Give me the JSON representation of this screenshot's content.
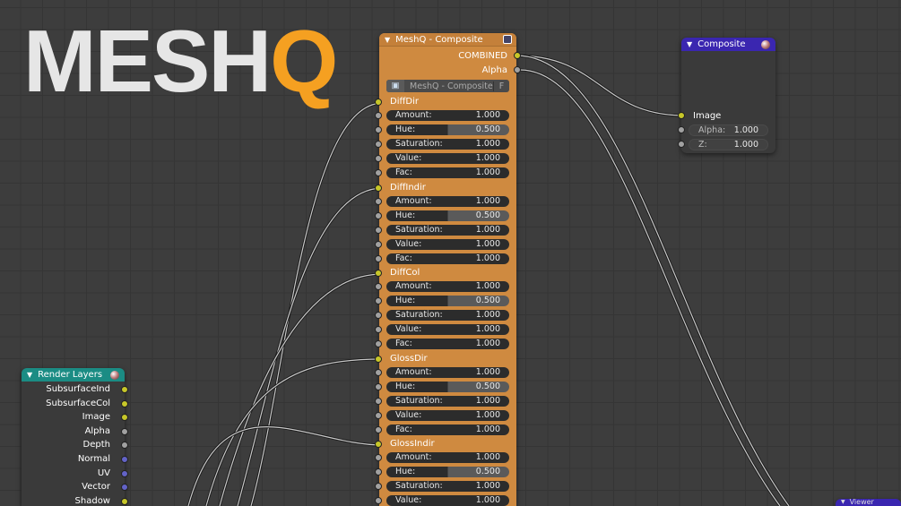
{
  "logo": {
    "text_main": "MESH",
    "text_accent": "Q"
  },
  "main_node": {
    "title": "MeshQ - Composite",
    "outputs": [
      "COMBINED",
      "Alpha"
    ],
    "group_selector": {
      "value": "MeshQ - Composite",
      "fake_user": "F"
    },
    "groups": [
      {
        "name": "DiffDir",
        "rows": [
          [
            "Amount:",
            "1.000"
          ],
          [
            "Hue:",
            "0.500"
          ],
          [
            "Saturation:",
            "1.000"
          ],
          [
            "Value:",
            "1.000"
          ],
          [
            "Fac:",
            "1.000"
          ]
        ]
      },
      {
        "name": "DiffIndir",
        "rows": [
          [
            "Amount:",
            "1.000"
          ],
          [
            "Hue:",
            "0.500"
          ],
          [
            "Saturation:",
            "1.000"
          ],
          [
            "Value:",
            "1.000"
          ],
          [
            "Fac:",
            "1.000"
          ]
        ]
      },
      {
        "name": "DiffCol",
        "rows": [
          [
            "Amount:",
            "1.000"
          ],
          [
            "Hue:",
            "0.500"
          ],
          [
            "Saturation:",
            "1.000"
          ],
          [
            "Value:",
            "1.000"
          ],
          [
            "Fac:",
            "1.000"
          ]
        ]
      },
      {
        "name": "GlossDir",
        "rows": [
          [
            "Amount:",
            "1.000"
          ],
          [
            "Hue:",
            "0.500"
          ],
          [
            "Saturation:",
            "1.000"
          ],
          [
            "Value:",
            "1.000"
          ],
          [
            "Fac:",
            "1.000"
          ]
        ]
      },
      {
        "name": "GlossIndir",
        "rows": [
          [
            "Amount:",
            "1.000"
          ],
          [
            "Hue:",
            "0.500"
          ],
          [
            "Saturation:",
            "1.000"
          ],
          [
            "Value:",
            "1.000"
          ]
        ]
      }
    ]
  },
  "composite_node": {
    "title": "Composite",
    "input": "Image",
    "fields": [
      [
        "Alpha:",
        "1.000"
      ],
      [
        "Z:",
        "1.000"
      ]
    ]
  },
  "render_layers": {
    "title": "Render Layers",
    "outputs": [
      [
        "SubsurfaceInd",
        "y"
      ],
      [
        "SubsurfaceCol",
        "y"
      ],
      [
        "Image",
        "y"
      ],
      [
        "Alpha",
        "g"
      ],
      [
        "Depth",
        "g"
      ],
      [
        "Normal",
        "b"
      ],
      [
        "UV",
        "b"
      ],
      [
        "Vector",
        "b"
      ],
      [
        "Shadow",
        "y"
      ]
    ]
  },
  "viewer_node": {
    "title": "Viewer"
  },
  "colors": {
    "main_header": "#c4803a",
    "main_body": "#cf8a40",
    "composite_header": "#3a26b0",
    "render_header": "#1b8c84",
    "node_body": "#3a3a3a"
  }
}
